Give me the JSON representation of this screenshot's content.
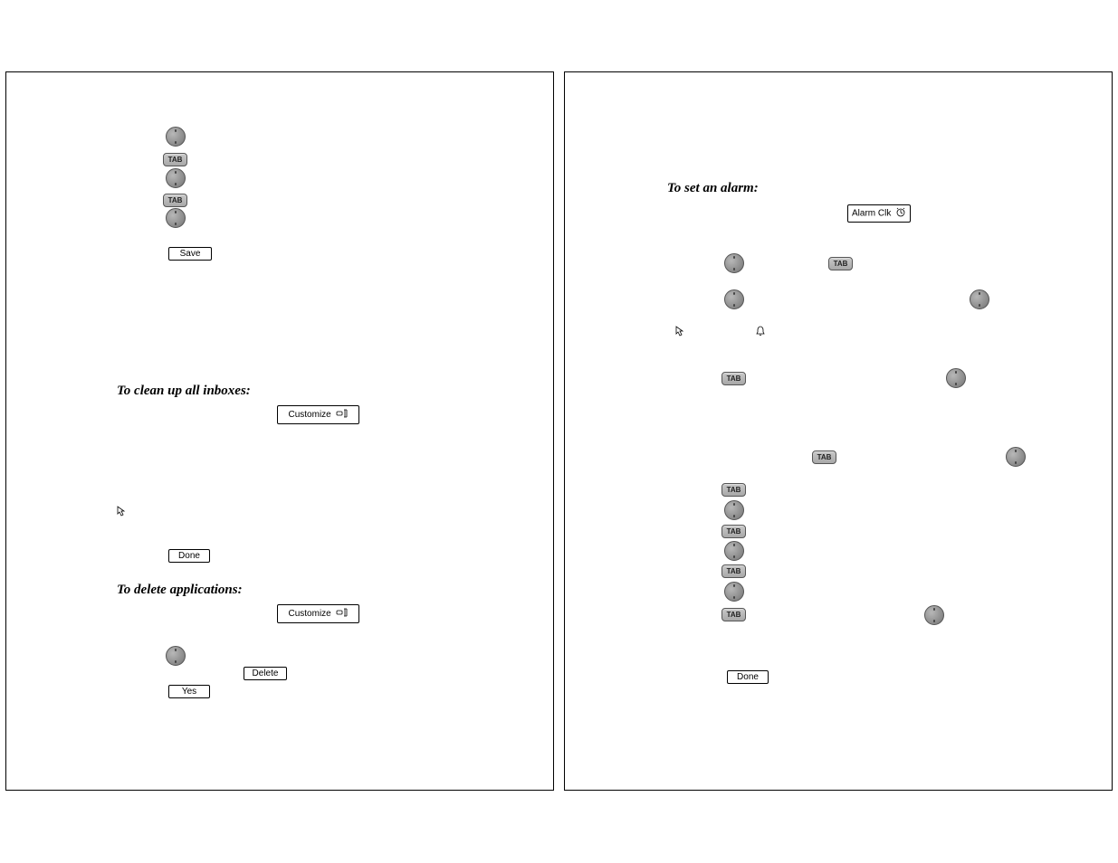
{
  "left": {
    "headings": {
      "cleanup": "To clean up all inboxes:",
      "delete_apps": "To delete applications:"
    },
    "buttons": {
      "save": "Save",
      "done": "Done",
      "customize1": "Customize",
      "customize2": "Customize",
      "delete": "Delete",
      "yes": "Yes"
    },
    "keys": {
      "tab": "TAB"
    }
  },
  "right": {
    "headings": {
      "set_alarm": "To set an alarm:"
    },
    "buttons": {
      "alarm_clk": "Alarm Clk",
      "done": "Done"
    },
    "keys": {
      "tab": "TAB"
    }
  }
}
